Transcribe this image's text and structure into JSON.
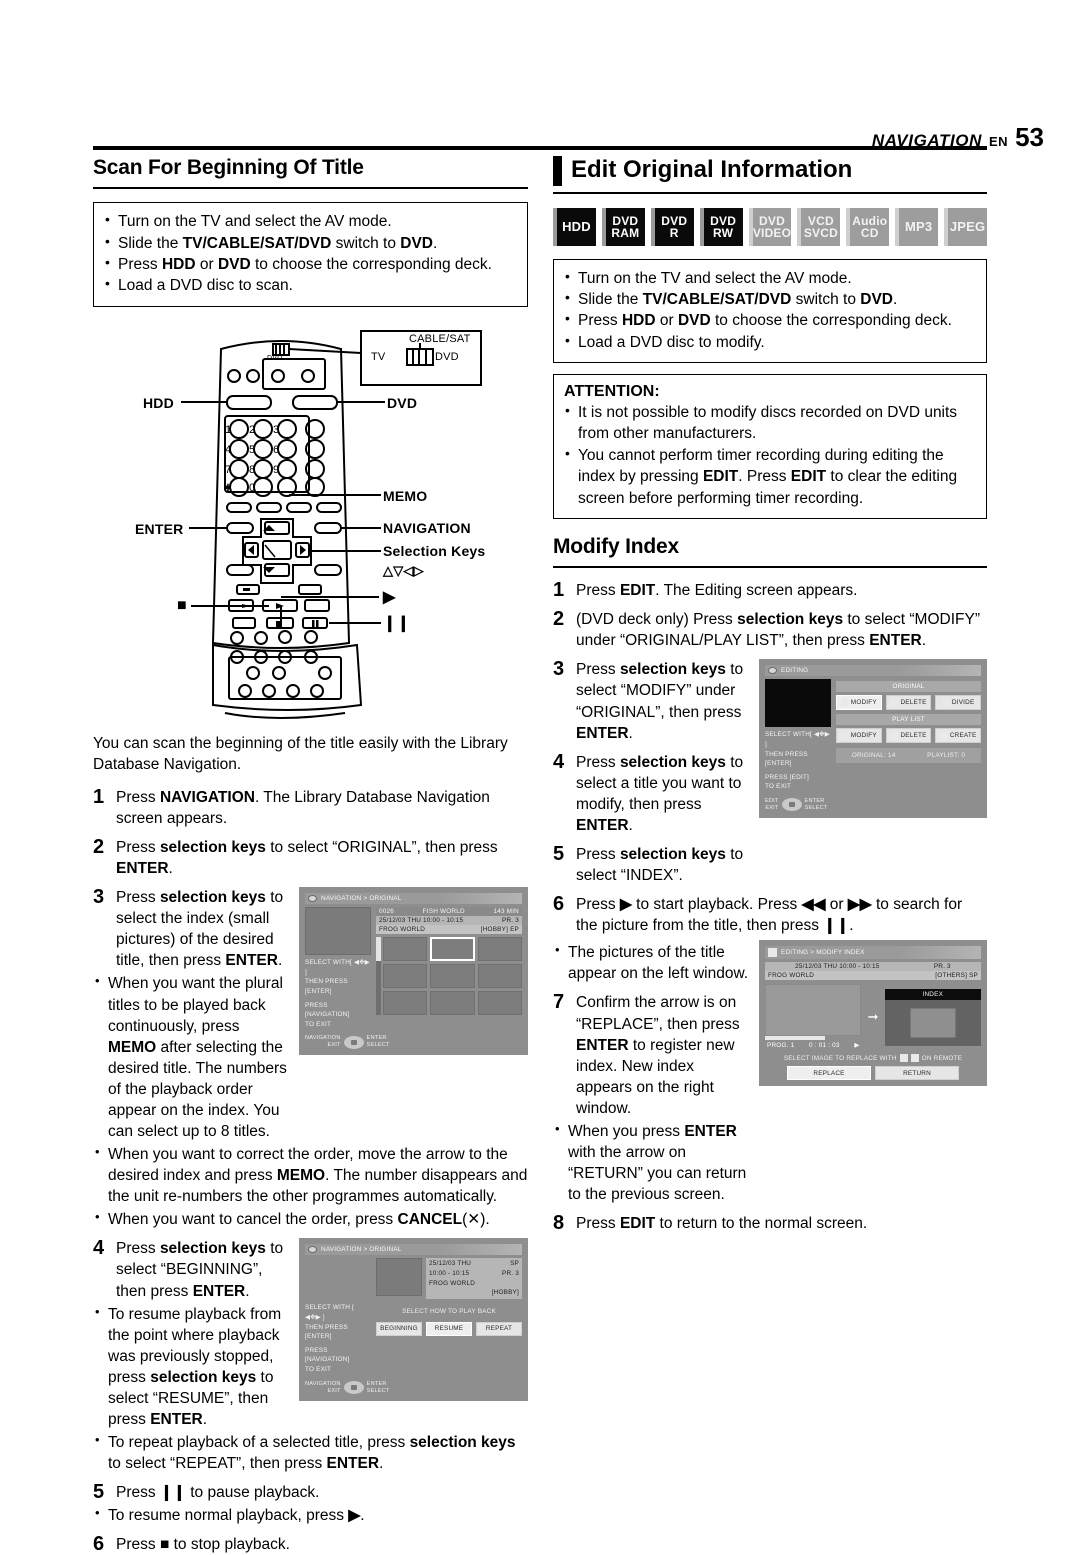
{
  "header": {
    "section": "NAVIGATION",
    "lang": "EN",
    "page": "53"
  },
  "left": {
    "title": "Scan For Beginning Of Title",
    "prereq": [
      "Turn on the TV and select the AV mode.",
      "Slide the <b>TV/CABLE/SAT/DVD</b> switch to <b>DVD</b>.",
      "Press <b>HDD</b> or <b>DVD</b> to choose the corresponding deck.",
      "Load a DVD disc to scan."
    ],
    "remote_labels": {
      "hdd": "HDD",
      "dvd": "DVD",
      "memo": "MEMO",
      "enter": "ENTER",
      "navigation": "NAVIGATION",
      "selection_keys": "Selection Keys",
      "selection_glyphs": "△▽◁▷",
      "switch_cablesat": "CABLE/SAT",
      "switch_tv": "TV",
      "switch_dvd": "DVD",
      "switch_top": "DVD",
      "play": "▶",
      "stop": "■",
      "pause": "❙❙"
    },
    "intro": "You can scan the beginning of the title easily with the Library Database Navigation.",
    "steps": [
      {
        "num": "1",
        "text": "Press <b>NAVIGATION</b>. The Library Database Navigation screen appears."
      },
      {
        "num": "2",
        "text": "Press <b>selection keys</b> to select “ORIGINAL”, then press <b>ENTER</b>."
      },
      {
        "num": "3",
        "text": "Press <b>selection keys</b> to select the index (small pictures) of the desired title, then press <b>ENTER</b>."
      },
      {
        "num": "4",
        "text": "Press <b>selection keys</b> to select “BEGINNING”, then press <b>ENTER</b>."
      },
      {
        "num": "5",
        "text": "Press <b>❙❙</b> to pause playback."
      },
      {
        "num": "6",
        "text": "Press <b>■</b> to stop playback."
      }
    ],
    "bullets_3": [
      "When you want the plural titles to be played back continuously, press <b>MEMO</b> after selecting the desired title. The numbers of the playback order appear on the index. You can select up to 8 titles.",
      "When you want to correct the order, move the arrow to the desired index and press <b>MEMO</b>. The number disappears and the unit re-numbers the other programmes automatically.",
      "When you want to cancel the order, press <b>CANCEL</b>(✕)."
    ],
    "bullets_4": [
      "To resume playback from the point where playback was previously stopped, press <b>selection keys</b> to select “RESUME”, then press <b>ENTER</b>.",
      "To repeat playback of a selected title, press <b>selection keys</b> to select “REPEAT”, then press <b>ENTER</b>."
    ],
    "bullets_5": [
      "To resume normal playback, press <b>▶</b>."
    ]
  },
  "right": {
    "title": "Edit Original Information",
    "badges": [
      {
        "lines": [
          "HDD"
        ],
        "state": "on"
      },
      {
        "lines": [
          "DVD",
          "RAM"
        ],
        "state": "on"
      },
      {
        "lines": [
          "DVD",
          "R"
        ],
        "state": "on"
      },
      {
        "lines": [
          "DVD",
          "RW"
        ],
        "state": "on"
      },
      {
        "lines": [
          "DVD",
          "VIDEO"
        ],
        "state": "off"
      },
      {
        "lines": [
          "VCD",
          "SVCD"
        ],
        "state": "off"
      },
      {
        "lines": [
          "Audio",
          "CD"
        ],
        "state": "off"
      },
      {
        "lines": [
          "MP3"
        ],
        "state": "off"
      },
      {
        "lines": [
          "JPEG"
        ],
        "state": "off"
      }
    ],
    "prereq": [
      "Turn on the TV and select the AV mode.",
      "Slide the <b>TV/CABLE/SAT/DVD</b> switch to <b>DVD</b>.",
      "Press <b>HDD</b> or <b>DVD</b> to choose the corresponding deck.",
      "Load a DVD disc to modify."
    ],
    "attention_title": "ATTENTION:",
    "attention": [
      "It is not possible to modify discs recorded on DVD units from other manufacturers.",
      "You cannot perform timer recording during editing the index by pressing <b>EDIT</b>. Press <b>EDIT</b> to clear the editing screen before performing timer recording."
    ],
    "subtitle": "Modify Index",
    "steps": [
      {
        "num": "1",
        "text": "Press <b>EDIT</b>. The Editing screen appears."
      },
      {
        "num": "2",
        "text": "(DVD deck only) Press <b>selection keys</b> to select “MODIFY” under “ORIGINAL/PLAY LIST”, then press <b>ENTER</b>."
      },
      {
        "num": "3",
        "text": "Press <b>selection keys</b> to select “MODIFY” under “ORIGINAL”, then press <b>ENTER</b>."
      },
      {
        "num": "4",
        "text": "Press <b>selection keys</b> to select a title you want to modify, then press <b>ENTER</b>."
      },
      {
        "num": "5",
        "text": "Press <b>selection keys</b> to select “INDEX”."
      },
      {
        "num": "6",
        "text": "Press <b>▶</b> to start playback. Press <b>◀◀</b> or <b>▶▶</b> to search for the picture from the title, then press <b>❙❙</b>."
      },
      {
        "num": "7",
        "text": "Confirm the arrow is on “REPLACE”, then press <b>ENTER</b> to register new index. New index appears on the right window."
      },
      {
        "num": "8",
        "text": "Press <b>EDIT</b> to return to the normal screen."
      }
    ],
    "bullets_6": [
      "The pictures of the title appear on the left window."
    ],
    "bullets_7": [
      "When you press <b>ENTER</b> with the arrow on “RETURN” you can return to the previous screen."
    ]
  },
  "screens": {
    "nav_original_grid": {
      "title": "NAVIGATION > ORIGINAL",
      "disc_no": "0026",
      "disc_name": "FISH WORLD",
      "duration": "143 MIN",
      "datetime": "25/12/03 THU 10:00 - 10:15",
      "pr": "PR. 3",
      "prog_title": "FROG WORLD",
      "genre": "[HOBBY]",
      "mode": "EP",
      "hint1": "SELECT WITH[ ◀✥▶ ]",
      "hint2": "THEN PRESS [ENTER]",
      "hint3": "PRESS [NAVIGATION]",
      "hint4": "TO EXIT",
      "key_left": "NAVIGATION",
      "key_left2": "EXIT",
      "key_right": "ENTER",
      "key_right2": "SELECT"
    },
    "nav_original_play": {
      "title": "NAVIGATION > ORIGINAL",
      "date": "25/12/03 THU",
      "time": "10:00 - 10:15",
      "mode": "SP",
      "pr": "PR.",
      "pr_no": "3",
      "prog_title": "FROG WORLD",
      "genre": "[HOBBY]",
      "prompt": "SELECT HOW TO PLAY BACK",
      "buttons": [
        "BEGINNING",
        "RESUME",
        "REPEAT"
      ],
      "selected": "RESUME",
      "hint1": "SELECT WITH [ ◀✥▶ ]",
      "hint2": "THEN PRESS [ENTER]",
      "hint3": "PRESS [NAVIGATION]",
      "hint4": "TO EXIT",
      "key_left": "NAVIGATION",
      "key_left2": "EXIT",
      "key_right": "ENTER",
      "key_right2": "SELECT"
    },
    "editing": {
      "title": "EDITING",
      "group1": "ORIGINAL",
      "group1_buttons": [
        "MODIFY",
        "DELETE",
        "DIVIDE"
      ],
      "group2": "PLAY LIST",
      "group2_buttons": [
        "MODIFY",
        "DELETE",
        "CREATE"
      ],
      "selected": "MODIFY",
      "count_original": "ORIGINAL: 14",
      "count_playlist": "PLAYLIST: 0",
      "hint1": "SELECT WITH[ ◀✥▶ ]",
      "hint2": "THEN PRESS [ENTER]",
      "hint3": "PRESS [EDIT]",
      "hint4": "TO EXIT",
      "key_left": "EDIT",
      "key_left2": "EXIT",
      "key_right": "ENTER",
      "key_right2": "SELECT"
    },
    "modify_index": {
      "title": "EDITING > MODIFY INDEX",
      "datetime": "25/12/03 THU 10:00 - 10:15",
      "pr": "PR. 3",
      "prog_title": "FROG WORLD",
      "genre": "[OTHERS]",
      "mode": "SP",
      "index_label": "INDEX",
      "prog_no": "PROG. 1",
      "timecode": "0 : 01 : 03",
      "instruction_pre": "SELECT IMAGE TO REPLACE WITH",
      "instruction_post": "ON REMOTE",
      "buttons": [
        "REPLACE",
        "RETURN"
      ],
      "selected": "REPLACE"
    }
  }
}
